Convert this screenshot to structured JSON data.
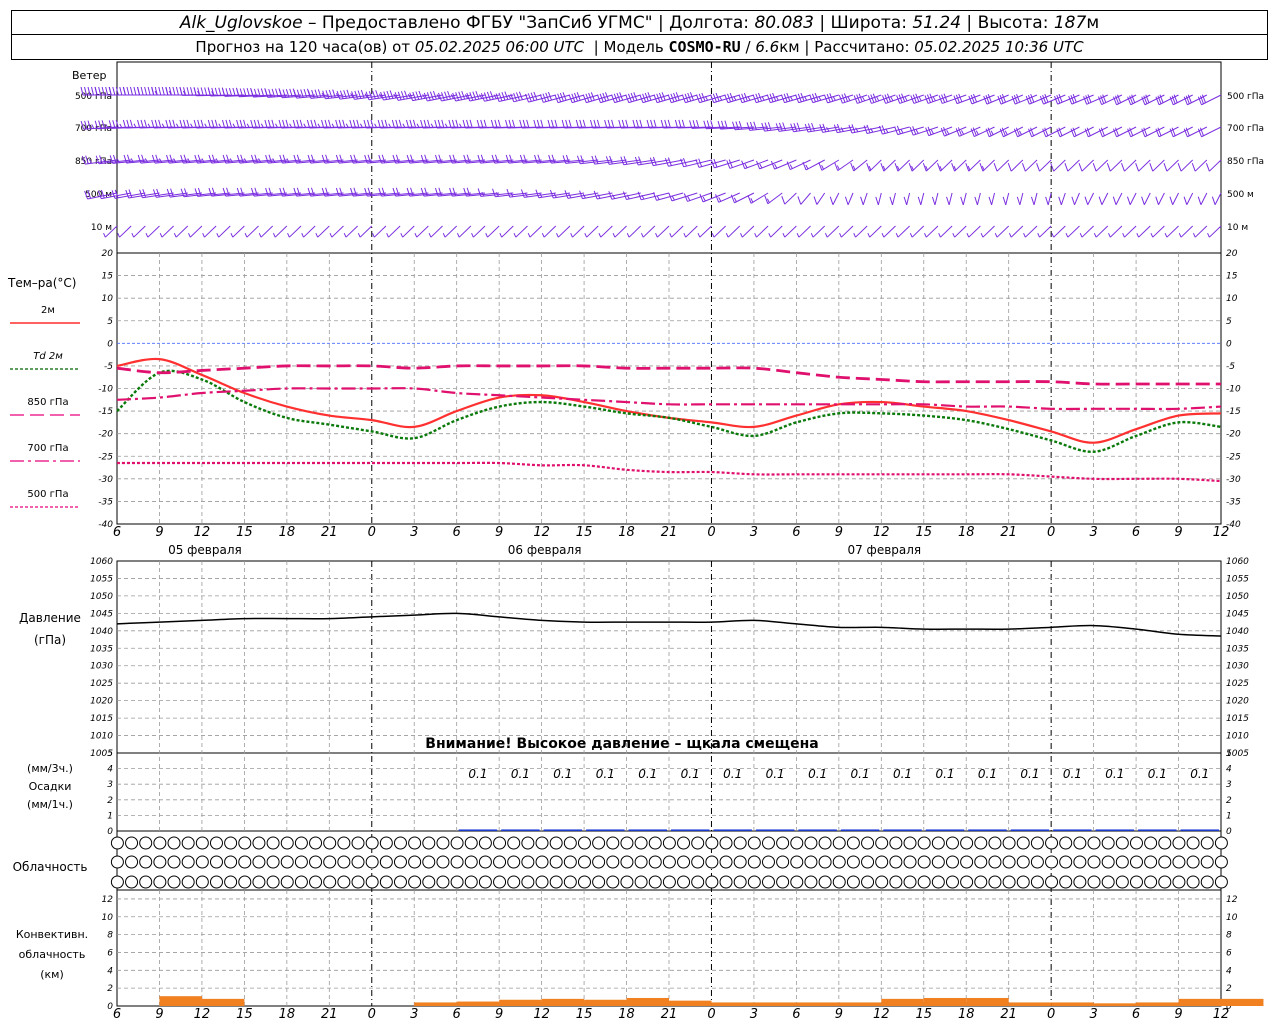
{
  "header": {
    "station": "Alk_Uglovskoe",
    "provider": "– Предоставлено ФГБУ \"ЗапСиб УГМС\"",
    "lon_label": "Долгота:",
    "lon_value": "80.083",
    "lat_label": "Широта:",
    "lat_value": "51.24",
    "alt_label": "Высота:",
    "alt_value": "187",
    "alt_unit": "м",
    "forecast_text": "Прогноз на 120 часа(ов) от",
    "forecast_time": "05.02.2025 06:00 UTC",
    "model_label": "Модель",
    "model_name": "COSMO-RU",
    "model_res": "6.6",
    "model_res_unit": "км",
    "calc_label": "Рассчитано:",
    "calc_time": "05.02.2025 10:36 UTC"
  },
  "wind": {
    "title": "Ветер",
    "levels": [
      "500 гПа",
      "700 гПа",
      "850 гПа",
      "500 м",
      "10 м"
    ]
  },
  "temperature": {
    "title": "Тем–ра(°C)",
    "legend": [
      {
        "label": "2м",
        "color": "#ff0000",
        "dash": "solid"
      },
      {
        "label": "Td 2м",
        "color": "#006400",
        "dash": "dotted"
      },
      {
        "label": "850 гПа",
        "color": "#e8007a",
        "dash": "long"
      },
      {
        "label": "700 гПа",
        "color": "#e8007a",
        "dash": "dashdot"
      },
      {
        "label": "500 гПа",
        "color": "#e8007a",
        "dash": "short"
      }
    ]
  },
  "pressure": {
    "title_1": "Давление",
    "title_2": "(гПа)",
    "warning": "Внимание! Высокое давление – щкала смещена"
  },
  "precip": {
    "title_1": "(мм/3ч.)",
    "title_2": "Осадки",
    "title_3": "(мм/1ч.)",
    "value_labels": [
      "0.1",
      "0.1",
      "0.1",
      "0.1",
      "0.1",
      "0.1",
      "0.1",
      "0.1",
      "0.1",
      "0.1",
      "0.1",
      "0.1",
      "0.1",
      "0.1",
      "0.1",
      "0.1",
      "0.1",
      "0.1"
    ]
  },
  "cloud": {
    "title": "Облачность"
  },
  "convective": {
    "title_1": "Конвективн.",
    "title_2": "облачность",
    "title_3": "(км)"
  },
  "time_axis": {
    "hour_labels": [
      "6",
      "9",
      "12",
      "15",
      "18",
      "21",
      "0",
      "3",
      "6",
      "9",
      "12",
      "15",
      "18",
      "21",
      "0",
      "3",
      "6",
      "9",
      "12",
      "15",
      "18",
      "21",
      "0",
      "3",
      "6",
      "9",
      "12"
    ],
    "date_labels": [
      "05 февраля",
      "06 февраля",
      "07 февраля"
    ]
  },
  "chart_data": [
    {
      "type": "line",
      "name": "temperature",
      "x": [
        0,
        3,
        6,
        9,
        12,
        15,
        18,
        21,
        24,
        27,
        30,
        33,
        36,
        39,
        42,
        45,
        48,
        51,
        54,
        57,
        60,
        63,
        66,
        69,
        72,
        75,
        78
      ],
      "x_hours_utc_start": "05.02.2025 06:00 UTC",
      "ylim": [
        -40,
        20
      ],
      "yticks": [
        20,
        15,
        10,
        5,
        0,
        -5,
        -10,
        -15,
        -20,
        -25,
        -30,
        -35,
        -40
      ],
      "series": [
        {
          "name": "2м",
          "color": "#ff3030",
          "values": [
            -5,
            -3.5,
            -7,
            -11,
            -14,
            -16,
            -17,
            -18.5,
            -15,
            -12,
            -11.5,
            -13,
            -15,
            -16.5,
            -17.5,
            -18.5,
            -16,
            -13.5,
            -13,
            -14,
            -15,
            -17,
            -19.5,
            -22,
            -19,
            -16,
            -15.5
          ]
        },
        {
          "name": "Td 2м",
          "color": "#0a7a0a",
          "values": [
            -15,
            -6.5,
            -8,
            -13,
            -16.5,
            -18,
            -19.5,
            -21,
            -17,
            -14,
            -13,
            -14,
            -15.5,
            -16.5,
            -18.5,
            -20.5,
            -17.5,
            -15.5,
            -15.5,
            -16,
            -17,
            -19,
            -21.5,
            -24,
            -20.5,
            -17.5,
            -18.5
          ]
        },
        {
          "name": "850 гПа",
          "color": "#e0106e",
          "values": [
            -5.5,
            -6.5,
            -6,
            -5.5,
            -5,
            -5,
            -5,
            -5.5,
            -5,
            -5,
            -5,
            -5,
            -5.5,
            -5.5,
            -5.5,
            -5.5,
            -6.5,
            -7.5,
            -8,
            -8.5,
            -8.5,
            -8.5,
            -8.5,
            -9,
            -9,
            -9,
            -9
          ]
        },
        {
          "name": "700 гПа",
          "color": "#e0106e",
          "values": [
            -12.5,
            -12,
            -11,
            -10.5,
            -10,
            -10,
            -10,
            -10,
            -11,
            -11.5,
            -12,
            -12.5,
            -13,
            -13.5,
            -13.5,
            -13.5,
            -13.5,
            -13.5,
            -13.5,
            -13.5,
            -14,
            -14,
            -14.5,
            -14.5,
            -14.5,
            -14.5,
            -14
          ]
        },
        {
          "name": "500 гПа",
          "color": "#e0106e",
          "values": [
            -26.5,
            -26.5,
            -26.5,
            -26.5,
            -26.5,
            -26.5,
            -26.5,
            -26.5,
            -26.5,
            -26.5,
            -27,
            -27,
            -28,
            -28.5,
            -28.5,
            -29,
            -29,
            -29,
            -29,
            -29,
            -29,
            -29,
            -29.5,
            -30,
            -30,
            -30,
            -30.5
          ]
        }
      ]
    },
    {
      "type": "line",
      "name": "pressure",
      "x": [
        0,
        3,
        6,
        9,
        12,
        15,
        18,
        21,
        24,
        27,
        30,
        33,
        36,
        39,
        42,
        45,
        48,
        51,
        54,
        57,
        60,
        63,
        66,
        69,
        72,
        75,
        78
      ],
      "ylim": [
        1005,
        1060
      ],
      "yticks": [
        1060,
        1055,
        1050,
        1045,
        1040,
        1035,
        1030,
        1025,
        1020,
        1015,
        1010,
        1005
      ],
      "series": [
        {
          "name": "Давление",
          "color": "#000000",
          "values": [
            1042,
            1042.5,
            1043,
            1043.5,
            1043.5,
            1043.5,
            1044,
            1044.5,
            1045,
            1044,
            1043,
            1042.5,
            1042.5,
            1042.5,
            1042.5,
            1043,
            1042,
            1041,
            1041,
            1040.5,
            1040.5,
            1040.5,
            1041,
            1041.5,
            1040.5,
            1039,
            1038.5
          ]
        }
      ]
    },
    {
      "type": "bar",
      "name": "precipitation",
      "ylim": [
        0,
        5
      ],
      "yticks": [
        5,
        4,
        3,
        2,
        1,
        0
      ],
      "x": [
        24,
        27,
        30,
        33,
        36,
        39,
        42,
        45,
        48,
        51,
        54,
        57,
        60,
        63,
        66,
        69,
        72,
        75
      ],
      "values": [
        0.1,
        0.1,
        0.1,
        0.1,
        0.1,
        0.1,
        0.1,
        0.1,
        0.1,
        0.1,
        0.1,
        0.1,
        0.1,
        0.1,
        0.1,
        0.1,
        0.1,
        0.1
      ]
    },
    {
      "type": "table",
      "name": "cloudiness",
      "rows": [
        "high",
        "middle",
        "low"
      ],
      "x": "one symbol per 1 hour, 0..78",
      "cover_fraction": {
        "high": [
          0,
          0,
          0,
          0,
          0,
          0,
          0,
          0,
          0,
          0,
          0,
          0,
          0,
          0,
          0,
          0,
          0,
          0,
          0,
          0,
          0,
          0,
          0,
          0,
          0,
          0,
          0,
          0,
          0,
          0,
          0,
          0,
          0,
          0,
          0,
          0,
          0,
          0,
          0,
          0,
          0,
          0,
          0,
          0,
          0,
          0,
          0,
          0,
          0,
          0,
          0,
          0,
          0,
          0,
          0,
          0,
          0,
          0,
          0,
          0,
          0,
          0,
          0,
          0,
          0,
          0,
          0,
          0,
          0,
          0,
          0,
          0,
          0,
          0,
          0,
          0,
          0,
          0,
          0
        ],
        "middle": [
          0,
          0,
          0,
          0,
          0,
          0,
          0,
          0,
          0,
          0,
          0,
          0,
          0,
          0,
          0,
          0,
          0,
          0,
          0,
          0,
          0,
          0,
          0,
          0,
          0,
          0,
          0,
          0,
          0,
          0,
          0,
          0,
          0,
          0,
          0,
          0,
          0,
          0,
          0,
          0,
          0,
          0,
          0,
          0,
          0,
          0,
          0,
          0,
          0,
          0,
          0,
          0,
          0,
          0,
          0,
          0,
          0,
          0,
          0,
          0,
          0,
          0,
          0,
          0,
          0,
          0,
          0,
          0,
          0,
          0,
          0,
          0,
          0,
          0,
          0,
          0,
          0,
          0,
          0
        ],
        "low": [
          0,
          0,
          0,
          0,
          0,
          0,
          0,
          0,
          0,
          0,
          0,
          0,
          0,
          0,
          0,
          0,
          0,
          0,
          0,
          0,
          0,
          0,
          0,
          0,
          0,
          0,
          0,
          0,
          0,
          0,
          0,
          0,
          0,
          0,
          0,
          0,
          0,
          0,
          0,
          0,
          0,
          0,
          0,
          0,
          0,
          0,
          0,
          0,
          0,
          0,
          0,
          0,
          0,
          0,
          0,
          0,
          0,
          0,
          0,
          0,
          0,
          0,
          0,
          0,
          0,
          0,
          0,
          0,
          0,
          0,
          0,
          0,
          0,
          0,
          0,
          0,
          0,
          0,
          0
        ]
      }
    },
    {
      "type": "area",
      "name": "convective cloudiness",
      "ylim": [
        0,
        13
      ],
      "yticks": [
        12,
        10,
        8,
        6,
        4,
        2,
        0
      ],
      "x": [
        3,
        6,
        21,
        24,
        27,
        30,
        33,
        36,
        39,
        42,
        45,
        48,
        51,
        54,
        57,
        60,
        63,
        66,
        69,
        72,
        75,
        78
      ],
      "values": [
        1.1,
        0.8,
        0.4,
        0.5,
        0.7,
        0.8,
        0.7,
        0.9,
        0.6,
        0.4,
        0.4,
        0.4,
        0.4,
        0.8,
        0.9,
        0.9,
        0.4,
        0.4,
        0.3,
        0.4,
        0.8,
        0.8
      ]
    },
    {
      "type": "table",
      "name": "wind barbs",
      "levels": [
        "500 гПа",
        "700 гПа",
        "850 гПа",
        "500 м",
        "10 м"
      ],
      "x": [
        0,
        3,
        6,
        9,
        12,
        15,
        18,
        21,
        24,
        27,
        30,
        33,
        36,
        39,
        42,
        45,
        48,
        51,
        54,
        57,
        60,
        63,
        66,
        69,
        72,
        75,
        78
      ],
      "dir_deg": {
        "500 гПа": [
          270,
          270,
          270,
          265,
          260,
          255,
          250,
          245,
          240,
          240,
          235,
          230,
          230,
          230,
          230,
          230,
          230,
          230,
          225,
          225,
          225,
          220,
          220,
          220,
          215,
          215,
          215
        ],
        "700 гПа": [
          260,
          265,
          265,
          265,
          265,
          265,
          265,
          265,
          265,
          265,
          265,
          265,
          265,
          265,
          265,
          260,
          250,
          245,
          240,
          230,
          220,
          215,
          215,
          215,
          215,
          215,
          215
        ],
        "850 гПа": [
          250,
          255,
          255,
          255,
          255,
          255,
          255,
          255,
          255,
          255,
          255,
          255,
          250,
          245,
          235,
          225,
          220,
          210,
          200,
          200,
          200,
          200,
          200,
          200,
          200,
          200,
          200
        ],
        "500 м": [
          240,
          245,
          250,
          255,
          255,
          255,
          255,
          255,
          255,
          255,
          250,
          245,
          240,
          235,
          225,
          215,
          200,
          190,
          185,
          185,
          185,
          185,
          185,
          190,
          190,
          190,
          190
        ],
        "10 м": [
          200,
          200,
          200,
          200,
          200,
          200,
          200,
          200,
          200,
          200,
          200,
          200,
          200,
          200,
          200,
          200,
          200,
          200,
          200,
          200,
          200,
          200,
          200,
          200,
          200,
          200,
          200
        ]
      },
      "speed_ms": {
        "500 гПа": [
          25,
          26,
          27,
          26,
          25,
          24,
          23,
          22,
          22,
          22,
          21,
          20,
          20,
          19,
          19,
          18,
          18,
          18,
          17,
          17,
          16,
          16,
          15,
          15,
          15,
          15,
          15
        ],
        "700 гПа": [
          18,
          18,
          18,
          18,
          17,
          17,
          17,
          17,
          17,
          16,
          16,
          16,
          16,
          16,
          15,
          15,
          14,
          14,
          13,
          13,
          12,
          12,
          11,
          11,
          11,
          11,
          11
        ],
        "850 гПа": [
          12,
          12,
          12,
          12,
          12,
          11,
          11,
          11,
          11,
          11,
          10,
          10,
          10,
          10,
          9,
          9,
          8,
          8,
          7,
          7,
          7,
          6,
          6,
          6,
          6,
          6,
          6
        ],
        "500 м": [
          9,
          9,
          9,
          9,
          9,
          9,
          9,
          9,
          9,
          9,
          8,
          8,
          8,
          8,
          7,
          7,
          6,
          6,
          5,
          5,
          5,
          5,
          5,
          5,
          5,
          5,
          5
        ],
        "10 м": [
          3,
          3,
          3,
          3,
          3,
          3,
          3,
          3,
          3,
          3,
          3,
          3,
          3,
          3,
          3,
          3,
          3,
          3,
          3,
          3,
          3,
          3,
          3,
          3,
          3,
          3,
          3
        ]
      }
    }
  ]
}
